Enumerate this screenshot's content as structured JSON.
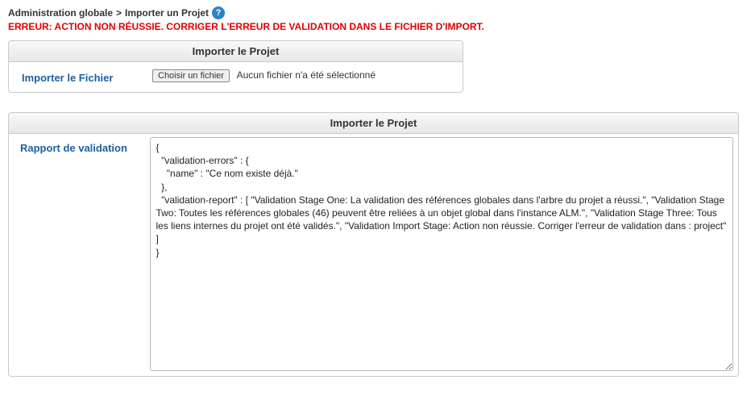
{
  "breadcrumb": {
    "root": "Administration globale",
    "sep": ">",
    "page": "Importer un Projet"
  },
  "error": "ERREUR: ACTION NON RÉUSSIE. CORRIGER L'ERREUR DE VALIDATION DANS LE FICHIER D'IMPORT.",
  "upload_panel": {
    "title": "Importer le Projet",
    "label": "Importer le Fichier",
    "button": "Choisir un fichier",
    "status": "Aucun fichier n'a été sélectionné"
  },
  "report_panel": {
    "title": "Importer le Projet",
    "label": "Rapport de validation",
    "content": "{\n  \"validation-errors\" : {\n    \"name\" : \"Ce nom existe déjà.\"\n  },\n  \"validation-report\" : [ \"Validation Stage One: La validation des références globales dans l'arbre du projet a réussi.\", \"Validation Stage Two: Toutes les références globales (46) peuvent être reliées à un objet global dans l'instance ALM.\", \"Validation Stage Three: Tous les liens internes du projet ont été validés.\", \"Validation Import Stage: Action non réussie. Corriger l'erreur de validation dans : project\" ]\n}"
  }
}
